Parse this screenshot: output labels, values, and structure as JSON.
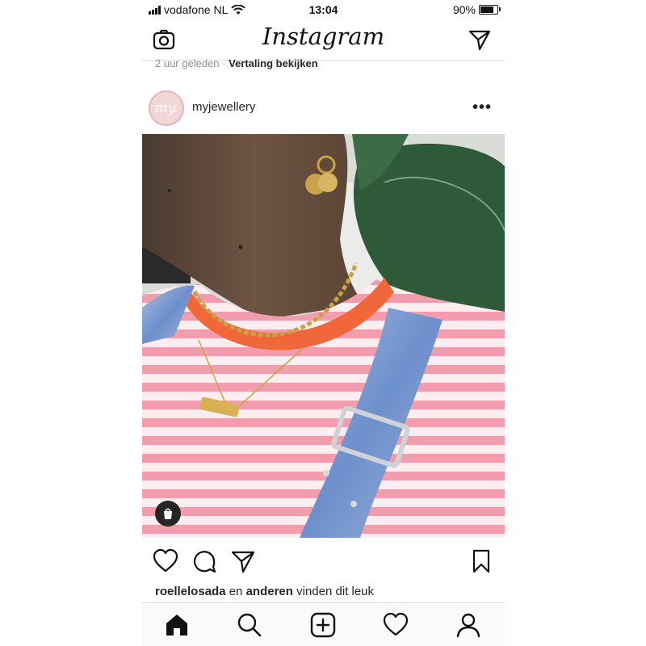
{
  "status_bar": {
    "carrier": "vodafone NL",
    "time": "13:04",
    "battery": "90%",
    "battery_level": 0.9
  },
  "header": {
    "logo": "Instagram",
    "left_icon": "camera-icon",
    "right_icon": "direct-send-icon"
  },
  "previous_post": {
    "timestamp": "2 uur geleden",
    "separator": "·",
    "translate_link": "Vertaling bekijken"
  },
  "post": {
    "avatar_text": "my.",
    "username": "myjewellery",
    "more": "•••",
    "photo_alt": "person wearing pink striped shirt with gold jewellery",
    "shopping_icon": "shopping-bag-icon"
  },
  "actions": {
    "like": "heart-icon",
    "comment": "comment-icon",
    "share": "share-icon",
    "save": "bookmark-icon"
  },
  "likes": {
    "user": "roellelosada",
    "connector": "en",
    "others": "anderen",
    "suffix": "vinden dit leuk"
  },
  "tab_bar": [
    {
      "name": "home",
      "icon": "home-icon"
    },
    {
      "name": "search",
      "icon": "search-icon"
    },
    {
      "name": "new-post",
      "icon": "plus-square-icon"
    },
    {
      "name": "activity",
      "icon": "heart-icon"
    },
    {
      "name": "profile",
      "icon": "profile-icon"
    }
  ],
  "colors": {
    "accent_orange": "#f0683a",
    "stripe_pink": "#f19dad",
    "denim": "#7f9fd2",
    "text": "#262626"
  }
}
